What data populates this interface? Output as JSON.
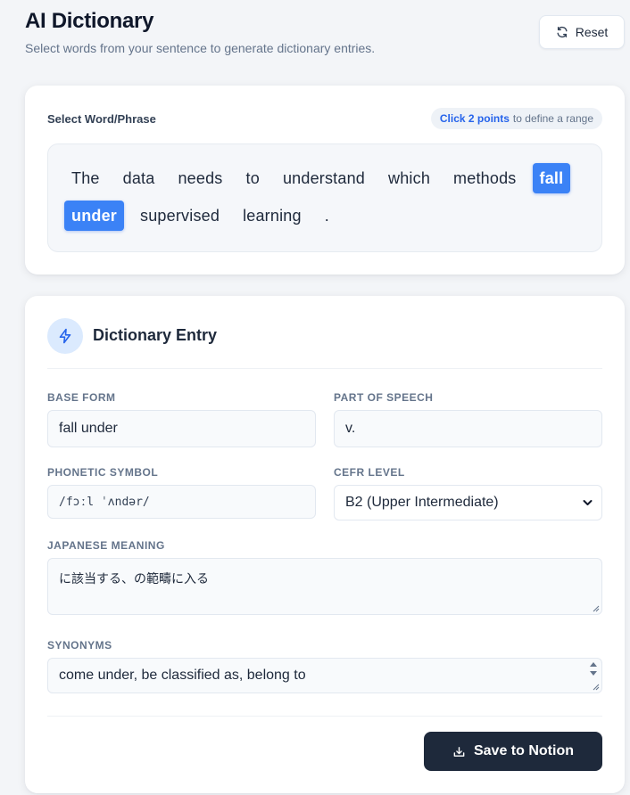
{
  "header": {
    "title": "AI Dictionary",
    "subtitle": "Select words from your sentence to generate dictionary entries.",
    "reset_label": "Reset"
  },
  "select_card": {
    "label": "Select Word/Phrase",
    "hint_highlight": "Click 2 points",
    "hint_rest": "to define a range",
    "tokens": [
      {
        "text": "The",
        "selected": false
      },
      {
        "text": "data",
        "selected": false
      },
      {
        "text": "needs",
        "selected": false
      },
      {
        "text": "to",
        "selected": false
      },
      {
        "text": "understand",
        "selected": false
      },
      {
        "text": "which",
        "selected": false
      },
      {
        "text": "methods",
        "selected": false
      },
      {
        "text": "fall",
        "selected": true
      },
      {
        "text": "under",
        "selected": true
      },
      {
        "text": "supervised",
        "selected": false
      },
      {
        "text": "learning",
        "selected": false
      },
      {
        "text": ".",
        "selected": false
      }
    ]
  },
  "entry_card": {
    "title": "Dictionary Entry",
    "icon": "lightning-icon",
    "base_form": {
      "label": "BASE FORM",
      "value": "fall under"
    },
    "part_of_speech": {
      "label": "PART OF SPEECH",
      "value": "v."
    },
    "phonetic": {
      "label": "PHONETIC SYMBOL",
      "value": "/fɔːl ˈʌndər/"
    },
    "cefr": {
      "label": "CEFR LEVEL",
      "value": "B2 (Upper Intermediate)"
    },
    "japanese_meaning": {
      "label": "JAPANESE MEANING",
      "value": "に該当する、の範疇に入る"
    },
    "synonyms": {
      "label": "SYNONYMS",
      "value": "come under, be classified as, belong to"
    },
    "save_label": "Save to Notion"
  },
  "colors": {
    "accent": "#3b82f6",
    "dark_button": "#1e293b",
    "icon_bg": "#dbeafe"
  }
}
